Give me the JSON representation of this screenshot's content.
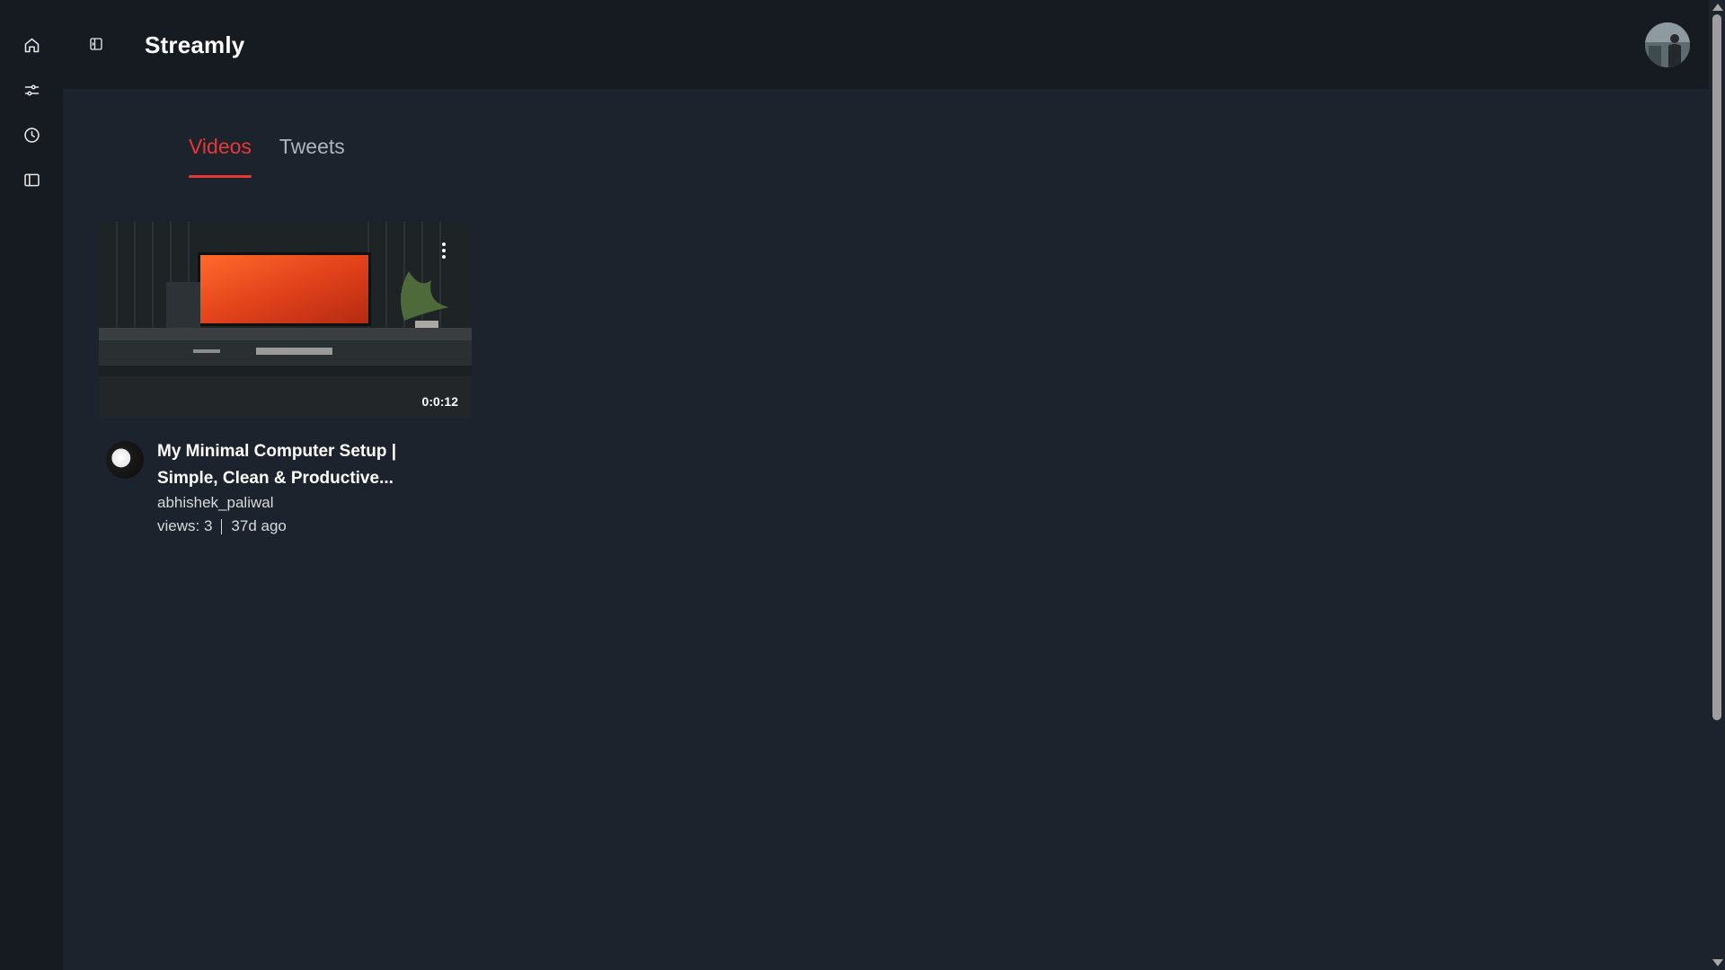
{
  "app": {
    "title": "Streamly"
  },
  "sidebar": {
    "items": [
      {
        "icon": "home-icon"
      },
      {
        "icon": "sliders-icon"
      },
      {
        "icon": "clock-icon"
      },
      {
        "icon": "sidebar-panel-icon"
      }
    ]
  },
  "header": {
    "collapse_icon": "sidebar-collapse-icon",
    "avatar": "user-avatar"
  },
  "tabs": [
    {
      "label": "Videos",
      "active": true
    },
    {
      "label": "Tweets",
      "active": false
    }
  ],
  "videos": [
    {
      "title": "My Minimal Computer Setup | Simple, Clean & Productive...",
      "duration": "0:0:12",
      "channel": "abhishek_paliwal",
      "views": "views: 3",
      "age": "37d ago"
    }
  ],
  "colors": {
    "background": "#1d232c",
    "panel": "#161b22",
    "accent": "#e53935"
  }
}
